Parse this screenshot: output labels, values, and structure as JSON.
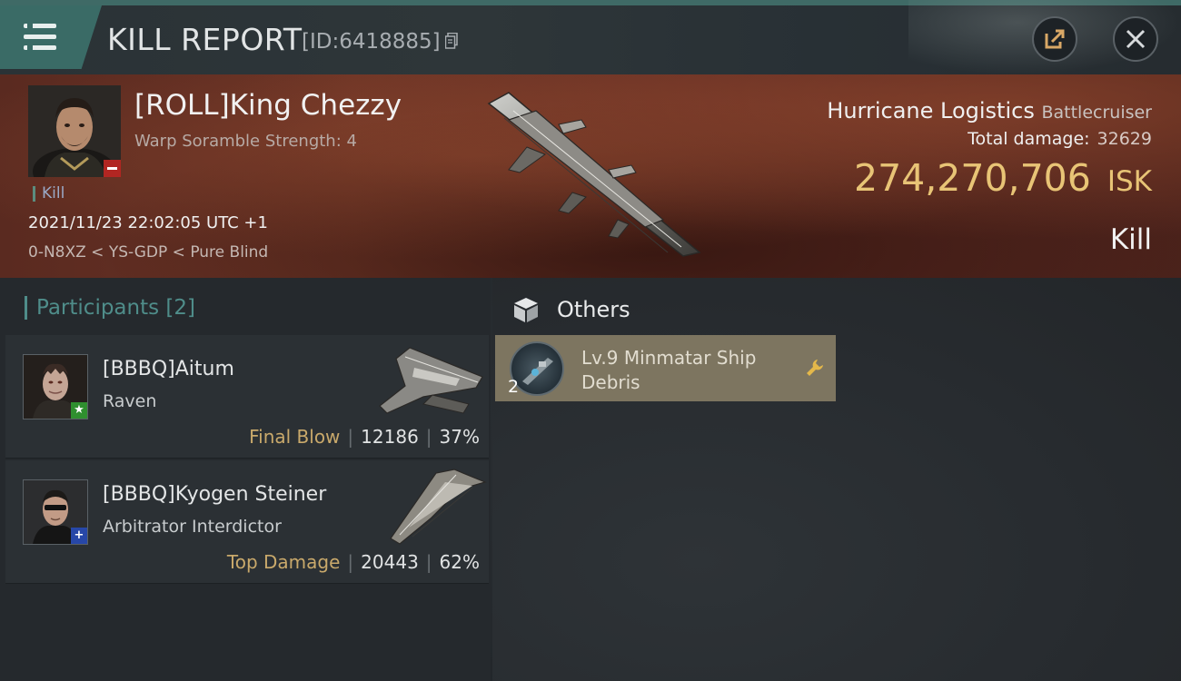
{
  "header": {
    "title": "KILL REPORT",
    "report_id": "[ID:6418885]"
  },
  "victim": {
    "name": "[ROLL]King Chezzy",
    "warp_scramble": "Warp Soramble Strength: 4",
    "type_tag": "Kill",
    "time": "2021/11/23 22:02:05 UTC +1",
    "location": "0-N8XZ < YS-GDP < Pure Blind",
    "ship_name": "Hurricane Logistics",
    "ship_class": "Battlecruiser",
    "total_damage_label": "Total damage:",
    "total_damage": "32629",
    "isk_value": "274,270,706",
    "isk_unit": "ISK",
    "result": "Kill"
  },
  "participants": {
    "label": "Participants",
    "count": "[2]",
    "items": [
      {
        "name": "[BBBQ]Aitum",
        "ship": "Raven",
        "tag": "Final Blow",
        "damage": "12186",
        "percent": "37%",
        "badge": "star"
      },
      {
        "name": "[BBBQ]Kyogen Steiner",
        "ship": "Arbitrator Interdictor",
        "tag": "Top Damage",
        "damage": "20443",
        "percent": "62%",
        "badge": "plus"
      }
    ]
  },
  "others": {
    "label": "Others",
    "items": [
      {
        "name": "Lv.9 Minmatar Ship Debris",
        "quantity": "2",
        "icon": "wrench-icon"
      }
    ]
  },
  "colors": {
    "accent_teal": "#3a6b66",
    "isk_gold": "#e8c476",
    "tag_gold": "#c9a96b",
    "negative_red": "#b12622",
    "star_green": "#2f8f2f",
    "plus_blue": "#2747a8"
  }
}
